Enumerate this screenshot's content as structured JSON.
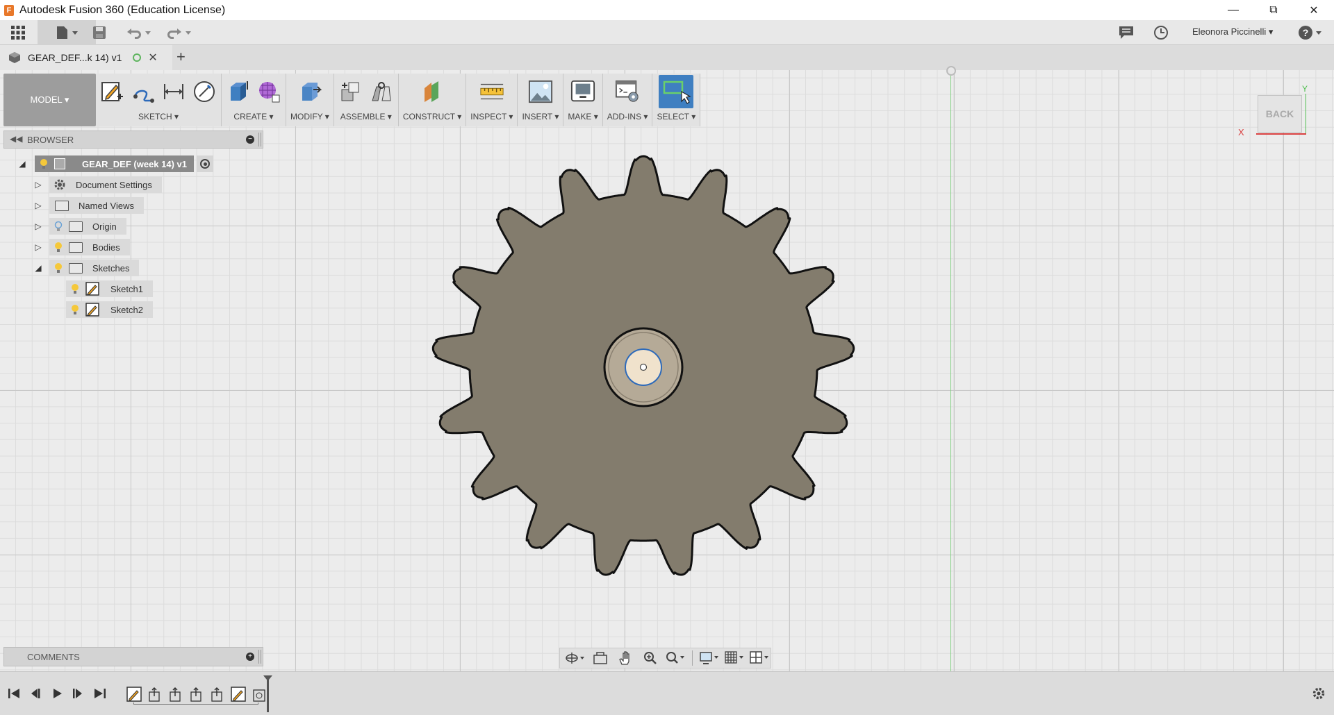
{
  "window": {
    "title": "Autodesk Fusion 360 (Education License)",
    "logo_letter": "F"
  },
  "appbar": {
    "user": "Eleonora Piccinelli ▾"
  },
  "tab": {
    "name": "GEAR_DEF...k 14) v1"
  },
  "toolbar": {
    "workspace": "MODEL ▾",
    "panels": [
      "SKETCH ▾",
      "CREATE ▾",
      "MODIFY ▾",
      "ASSEMBLE ▾",
      "CONSTRUCT ▾",
      "INSPECT ▾",
      "INSERT ▾",
      "MAKE ▾",
      "ADD-INS ▾",
      "SELECT ▾"
    ]
  },
  "browser": {
    "title": "BROWSER",
    "root": "GEAR_DEF (week 14) v1",
    "items": [
      {
        "label": "Document Settings"
      },
      {
        "label": "Named Views"
      },
      {
        "label": "Origin"
      },
      {
        "label": "Bodies"
      },
      {
        "label": "Sketches"
      },
      {
        "label": "Sketch1"
      },
      {
        "label": "Sketch2"
      }
    ]
  },
  "comments": {
    "title": "COMMENTS"
  },
  "viewcube": {
    "face": "BACK",
    "axis_x": "X",
    "axis_y": "Y"
  },
  "colors": {
    "gear_fill": "#837c6d",
    "hub_fill": "#b5aa97",
    "bore_fill": "#f0e2cc",
    "selected_blue": "#2d6aba",
    "select_tool_bg": "#3f7fc1",
    "y_axis": "#7fd07f",
    "x_axis": "#d94040"
  }
}
